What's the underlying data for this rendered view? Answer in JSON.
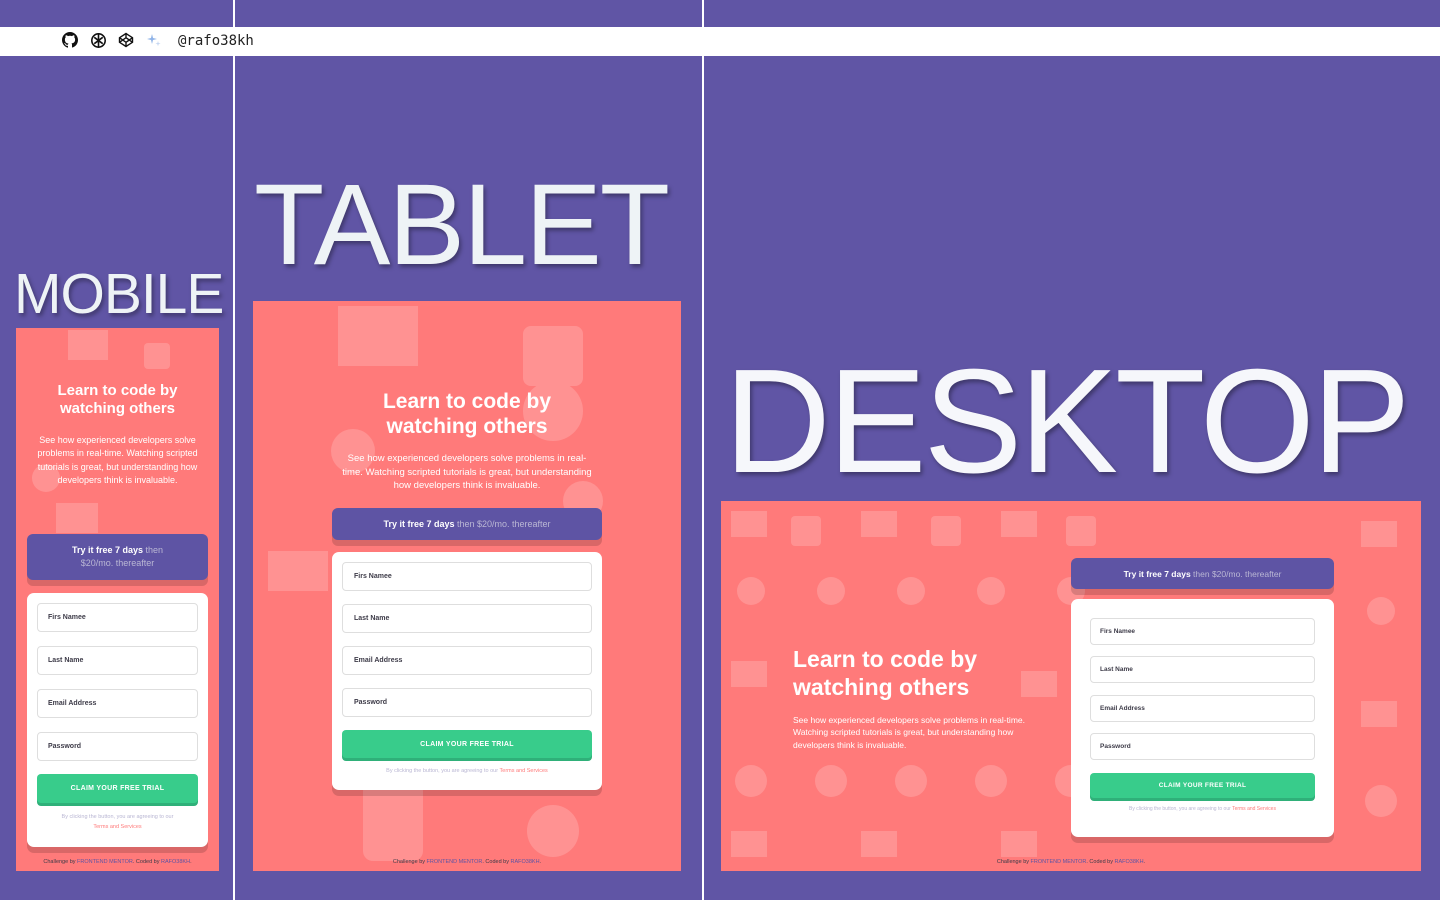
{
  "topbar": {
    "icons": [
      "github-icon",
      "openai-icon",
      "codepen-icon",
      "sparkle-icon"
    ],
    "handle": "@rafo38kh"
  },
  "columns": {
    "mobile_title": "MOBILE",
    "tablet_title": "TABLET",
    "desktop_title": "DESKTOP"
  },
  "page": {
    "heading_line1": "Learn to code by",
    "heading_line2": "watching others",
    "intro_text": "See how experienced developers solve problems in real-time. Watching scripted tutorials is great, but understanding how developers think is invaluable.",
    "trial_bold": "Try it free 7 days",
    "trial_rest": " then $20/mo. thereafter",
    "fields": {
      "first_name": "Firs Namee",
      "last_name": "Last Name",
      "email": "Email Address",
      "password": "Password"
    },
    "cta_label": "CLAIM YOUR FREE TRIAL",
    "terms_prefix": "By clicking the button, you are agreeing to our ",
    "terms_link": "Terms and Services",
    "attrib_prefix": "Challenge by ",
    "attrib_fm": "FRONTEND MENTOR",
    "attrib_mid": ". Coded by ",
    "attrib_author": "RAFO38KH",
    "attrib_end": "."
  },
  "colors": {
    "background": "#6055a5",
    "panel": "#ff7a7a",
    "accent_purple": "#5e54a4",
    "accent_green": "#38cc8b"
  }
}
